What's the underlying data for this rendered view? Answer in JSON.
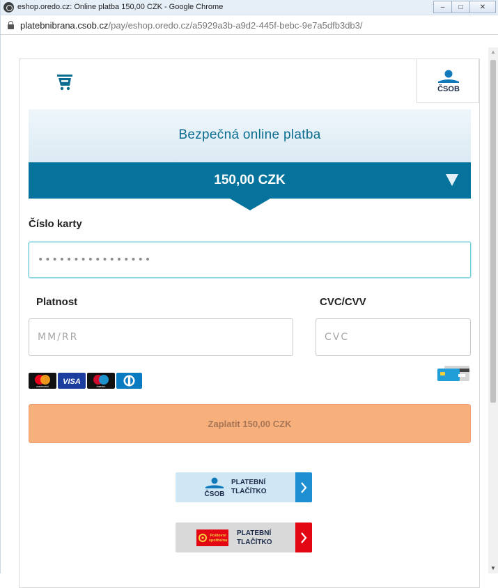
{
  "window": {
    "title": "eshop.oredo.cz: Online platba 150,00 CZK - Google Chrome",
    "url_host": "platebnibrana.csob.cz",
    "url_path": "/pay/eshop.oredo.cz/a5929a3b-a9d2-445f-bebc-9e7a5dfb3db3/"
  },
  "header": {
    "secure_title": "Bezpečná online platba",
    "amount": "150,00 CZK"
  },
  "form": {
    "card_number_label": "Číslo karty",
    "card_number_value": "••••••••••••••••",
    "expiry_label": "Platnost",
    "expiry_placeholder": "MM/RR",
    "cvc_label": "CVC/CVV",
    "cvc_placeholder": "CVC",
    "pay_label": "Zaplatit 150,00 CZK"
  },
  "brands": {
    "mastercard_text": "mastercard",
    "visa_text": "VISA",
    "maestro_text": "maestro"
  },
  "alt_buttons": [
    {
      "logo": "ČSOB",
      "line1": "PLATEBNÍ",
      "line2": "TLAČÍTKO",
      "accent": "#1e8fd0",
      "bg": "#cfe6f5"
    },
    {
      "logo_line1": "Poštovní",
      "logo_line2": "spořitelna",
      "line1": "PLATEBNÍ",
      "line2": "TLAČÍTKO",
      "accent": "#e30613",
      "bg": "#d9d9d9"
    }
  ],
  "csob_logo_text": "ČSOB",
  "colors": {
    "primary_blue": "#05739b",
    "pay_button": "#f7b07c"
  }
}
